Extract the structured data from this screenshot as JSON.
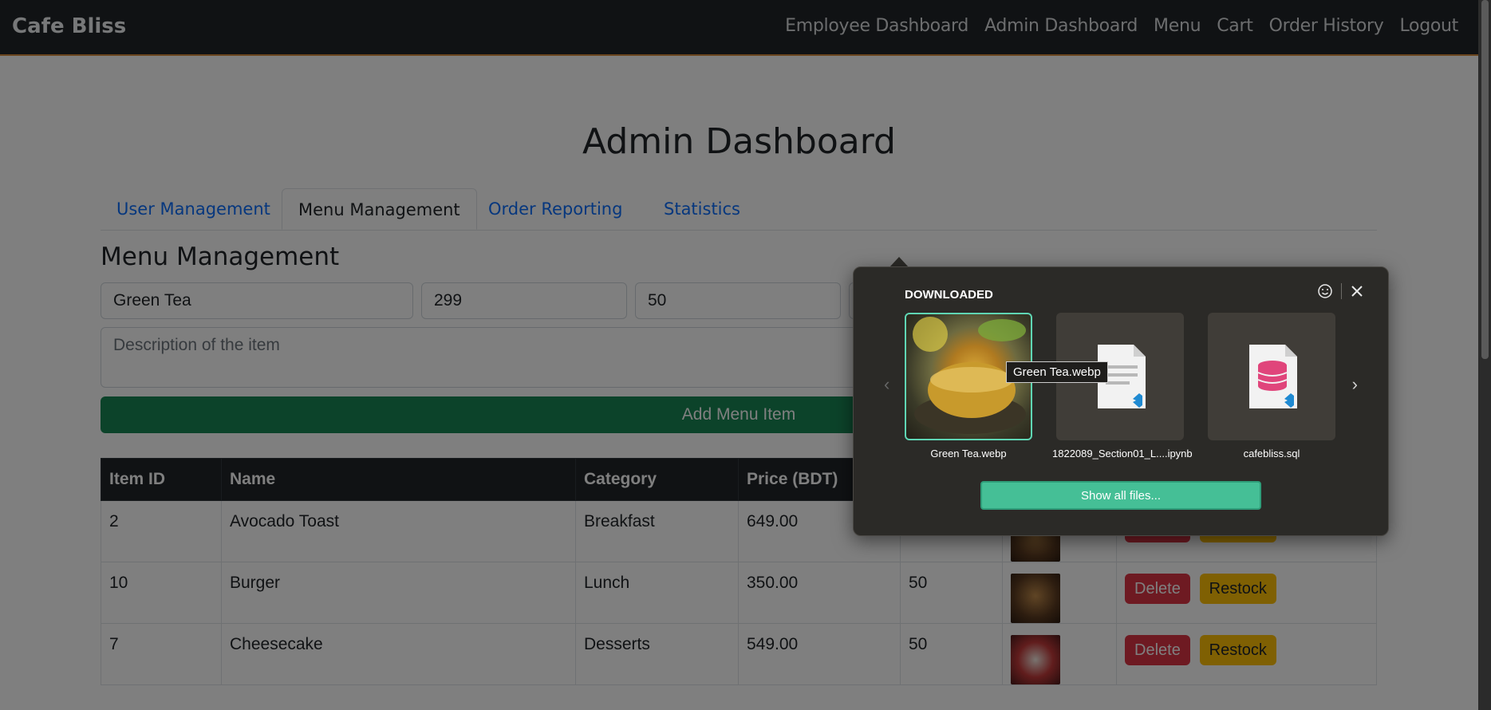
{
  "navbar": {
    "brand": "Cafe Bliss",
    "links": [
      "Employee Dashboard",
      "Admin Dashboard",
      "Menu",
      "Cart",
      "Order History",
      "Logout"
    ]
  },
  "page": {
    "title": "Admin Dashboard",
    "tabs": [
      "User Management",
      "Menu Management",
      "Order Reporting",
      "Statistics"
    ],
    "active_tab": "Menu Management",
    "section_title": "Menu Management"
  },
  "form": {
    "name_value": "Green Tea",
    "price_value": "299",
    "stock_value": "50",
    "description_placeholder": "Description of the item",
    "add_button": "Add Menu Item"
  },
  "table": {
    "headers": [
      "Item ID",
      "Name",
      "Category",
      "Price (BDT)"
    ],
    "rows": [
      {
        "id": "2",
        "name": "Avocado Toast",
        "category": "Breakfast",
        "price": "649.00",
        "stock": ""
      },
      {
        "id": "10",
        "name": "Burger",
        "category": "Lunch",
        "price": "350.00",
        "stock": "50"
      },
      {
        "id": "7",
        "name": "Cheesecake",
        "category": "Desserts",
        "price": "549.00",
        "stock": "50"
      }
    ],
    "delete_label": "Delete",
    "restock_label": "Restock"
  },
  "downloads": {
    "title": "DOWNLOADED",
    "files": [
      "Green Tea.webp",
      "1822089_Section01_L....ipynb",
      "cafebliss.sql"
    ],
    "tooltip": "Green Tea.webp",
    "show_all": "Show all files..."
  },
  "colors": {
    "navbar": "#212529",
    "success": "#198754",
    "danger": "#dc3545",
    "warning": "#ffc107",
    "accent": "#45bf96"
  }
}
